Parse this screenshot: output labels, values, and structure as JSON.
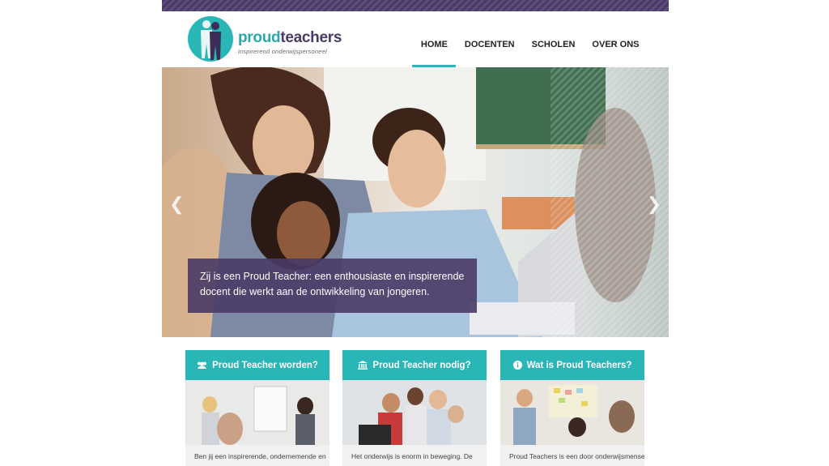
{
  "brand": {
    "name_part1": "proud",
    "name_part2": "teachers",
    "tagline": "inspirerend onderwijspersoneel",
    "accent": "#2ab6b6",
    "purple": "#4a3a66"
  },
  "nav": {
    "items": [
      {
        "label": "HOME",
        "active": true
      },
      {
        "label": "DOCENTEN"
      },
      {
        "label": "SCHOLEN"
      },
      {
        "label": "OVER ONS"
      }
    ]
  },
  "hero": {
    "caption_line1": "Zij is een Proud Teacher: een enthousiaste en inspirerende",
    "caption_line2": "docent die werkt aan de ontwikkeling van jongeren.",
    "prev_icon": "chevron-left-icon",
    "next_icon": "chevron-right-icon"
  },
  "cards": [
    {
      "icon": "users-icon",
      "title": "Proud Teacher worden?",
      "text": "Ben jij een inspirerende, ondernemende en"
    },
    {
      "icon": "institution-icon",
      "title": "Proud Teacher nodig?",
      "text": "Het onderwijs is enorm in beweging. De"
    },
    {
      "icon": "info-circle-icon",
      "title": "Wat is Proud Teachers?",
      "text": "Proud Teachers is een door onderwijsmensen"
    }
  ]
}
